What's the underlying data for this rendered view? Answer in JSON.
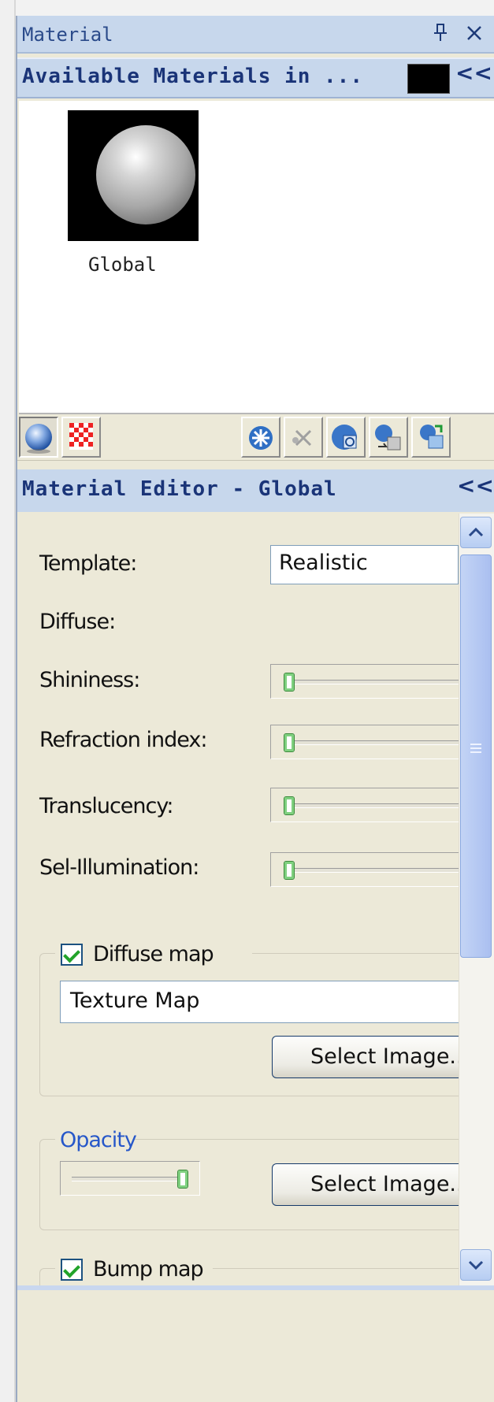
{
  "window": {
    "title": "Material"
  },
  "available_materials": {
    "header": "Available Materials in ...",
    "items": [
      {
        "label": "Global"
      }
    ]
  },
  "toolbar": {
    "buttons": [
      {
        "name": "sphere-preview-icon"
      },
      {
        "name": "checker-background-icon"
      },
      {
        "name": "create-material-icon"
      },
      {
        "name": "delete-material-icon"
      },
      {
        "name": "apply-material-icon"
      },
      {
        "name": "transfer-material-icon"
      },
      {
        "name": "import-material-icon"
      }
    ]
  },
  "editor": {
    "header": "Material Editor - Global",
    "template_label": "Template:",
    "template_value": "Realistic",
    "diffuse_label": "Diffuse:",
    "sliders": [
      {
        "label": "Shininess:",
        "value": 0
      },
      {
        "label": "Refraction index:",
        "value": 0
      },
      {
        "label": "Translucency:",
        "value": 0
      },
      {
        "label": "Sel-Illumination:",
        "value": 0
      }
    ],
    "diffuse_map": {
      "label": "Diffuse map",
      "checked": true,
      "texture_value": "Texture Map",
      "select_button": "Select Image..."
    },
    "opacity": {
      "label": "Opacity",
      "value": 1,
      "select_button": "Select Image..."
    },
    "bump_map": {
      "label": "Bump map",
      "checked": true
    }
  },
  "colors": {
    "title_bar": "#c7d7ec",
    "header_text": "#1a3478",
    "panel_bg": "#ece9d8",
    "checkbox_tick": "#22a32a",
    "scroll_accent": "#b7cdf2"
  }
}
